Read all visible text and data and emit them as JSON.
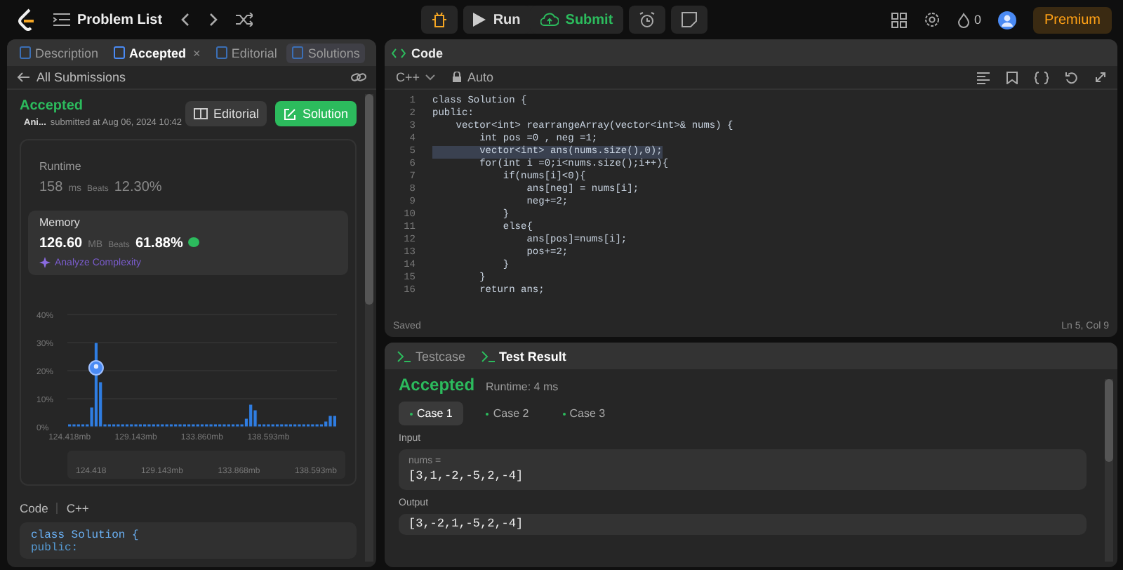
{
  "top_bar": {
    "problem_list": "Problem List",
    "run": "Run",
    "submit": "Submit",
    "streak": "0",
    "premium": "Premium"
  },
  "left_panel": {
    "tabs": [
      {
        "label": "Description",
        "selected": false
      },
      {
        "label": "Accepted",
        "selected": true,
        "close": "×"
      },
      {
        "label": "Editorial",
        "selected": false
      },
      {
        "label": "Solutions",
        "selected": false
      }
    ],
    "back_link": "All Submissions",
    "status": "Accepted",
    "user": "Ani...",
    "submitted": "submitted at Aug 06, 2024 10:42",
    "editorial_button": "Editorial",
    "solution_button": "Solution",
    "runtime": {
      "label": "Runtime",
      "value": "158",
      "unit": "ms",
      "beats_label": "Beats",
      "beats": "12.30%",
      "selected": false
    },
    "memory": {
      "label": "Memory",
      "value": "126.60",
      "unit": "MB",
      "beats_label": "Beats",
      "beats": "61.88%",
      "selected": true
    },
    "analyze": "Analyze Complexity",
    "chart_data": {
      "type": "bar",
      "grid": true,
      "x": [
        124.418,
        124.733,
        125.048,
        125.363,
        125.678,
        125.993,
        126.308,
        126.623,
        126.938,
        127.253,
        127.568,
        127.883,
        128.198,
        128.513,
        128.828,
        129.143,
        129.458,
        129.773,
        130.088,
        130.403,
        130.718,
        131.033,
        131.348,
        131.663,
        131.978,
        132.293,
        132.608,
        132.923,
        133.238,
        133.553,
        133.868,
        134.183,
        134.498,
        134.813,
        135.128,
        135.443,
        135.758,
        136.073,
        136.388,
        136.703,
        137.018,
        137.333,
        137.648,
        137.963,
        138.278,
        138.593,
        138.908,
        139.223,
        139.538,
        139.853,
        140.168,
        140.483,
        140.798,
        141.113,
        141.428,
        141.743,
        142.058,
        142.373,
        142.688,
        143.003,
        143.318
      ],
      "xlim": [
        124.26,
        143.476
      ],
      "values": [
        1,
        1,
        1,
        1,
        1,
        7,
        30,
        16,
        1,
        1,
        1,
        1,
        1,
        1,
        1,
        1,
        1,
        1,
        1,
        1,
        1,
        1,
        1,
        1,
        1,
        1,
        1,
        1,
        1,
        1,
        1,
        1,
        1,
        1,
        1,
        1,
        1,
        1,
        1,
        1,
        3,
        8,
        6,
        1,
        1,
        1,
        1,
        1,
        1,
        1,
        1,
        1,
        1,
        1,
        1,
        1,
        1,
        1,
        2,
        4,
        4
      ],
      "ylim": [
        0,
        40
      ],
      "yticks": [
        {
          "value": 0,
          "label": "0%"
        },
        {
          "value": 10,
          "label": "10%"
        },
        {
          "value": 20,
          "label": "20%"
        },
        {
          "value": 30,
          "label": "30%"
        },
        {
          "value": 40,
          "label": "40%"
        }
      ],
      "xticks": [
        {
          "value": 124.418,
          "label": "124.418mb"
        },
        {
          "value": 129.143,
          "label": "129.143mb"
        },
        {
          "value": 133.86,
          "label": "133.860mb"
        },
        {
          "value": 138.593,
          "label": "138.593mb"
        }
      ]
    },
    "range_labels": [
      "124.418",
      "129.143mb",
      "133.868mb",
      "138.593mb"
    ],
    "code_label": "Code",
    "code_lang": "C++",
    "code_lines": [
      "class Solution {",
      "public:"
    ]
  },
  "editor": {
    "title": "Code",
    "language": "C++",
    "mode": "Auto",
    "lines": [
      {
        "num": "1",
        "text": "class Solution {",
        "selected": false
      },
      {
        "num": "2",
        "text": "public:",
        "selected": false
      },
      {
        "num": "3",
        "text": "    vector<int> rearrangeArray(vector<int>& nums) {",
        "selected": false
      },
      {
        "num": "4",
        "text": "        int pos =0 , neg =1;",
        "selected": false
      },
      {
        "num": "5",
        "text": "        vector<int> ans(nums.size(),0);",
        "selected": true
      },
      {
        "num": "6",
        "text": "        for(int i =0;i<nums.size();i++){",
        "selected": false
      },
      {
        "num": "7",
        "text": "            if(nums[i]<0){",
        "selected": false
      },
      {
        "num": "8",
        "text": "                ans[neg] = nums[i];",
        "selected": false
      },
      {
        "num": "9",
        "text": "                neg+=2;",
        "selected": false
      },
      {
        "num": "10",
        "text": "            }",
        "selected": false
      },
      {
        "num": "11",
        "text": "            else{",
        "selected": false
      },
      {
        "num": "12",
        "text": "                ans[pos]=nums[i];",
        "selected": false
      },
      {
        "num": "13",
        "text": "                pos+=2;",
        "selected": false
      },
      {
        "num": "14",
        "text": "            }",
        "selected": false
      },
      {
        "num": "15",
        "text": "        }",
        "selected": false
      },
      {
        "num": "16",
        "text": "        return ans;",
        "selected": false
      }
    ],
    "saved": "Saved",
    "cursor": "Ln 5, Col 9"
  },
  "result_panel": {
    "tabs": [
      {
        "label": "Testcase",
        "selected": false
      },
      {
        "label": "Test Result",
        "selected": true
      }
    ],
    "status": "Accepted",
    "runtime": "Runtime: 4 ms",
    "cases": [
      {
        "label": "Case 1",
        "selected": true
      },
      {
        "label": "Case 2",
        "selected": false
      },
      {
        "label": "Case 3",
        "selected": false
      }
    ],
    "input_label": "Input",
    "input_name": "nums =",
    "input_value": "[3,1,-2,-5,2,-4]",
    "output_label": "Output",
    "output_value": "[3,-2,1,-5,2,-4]"
  }
}
